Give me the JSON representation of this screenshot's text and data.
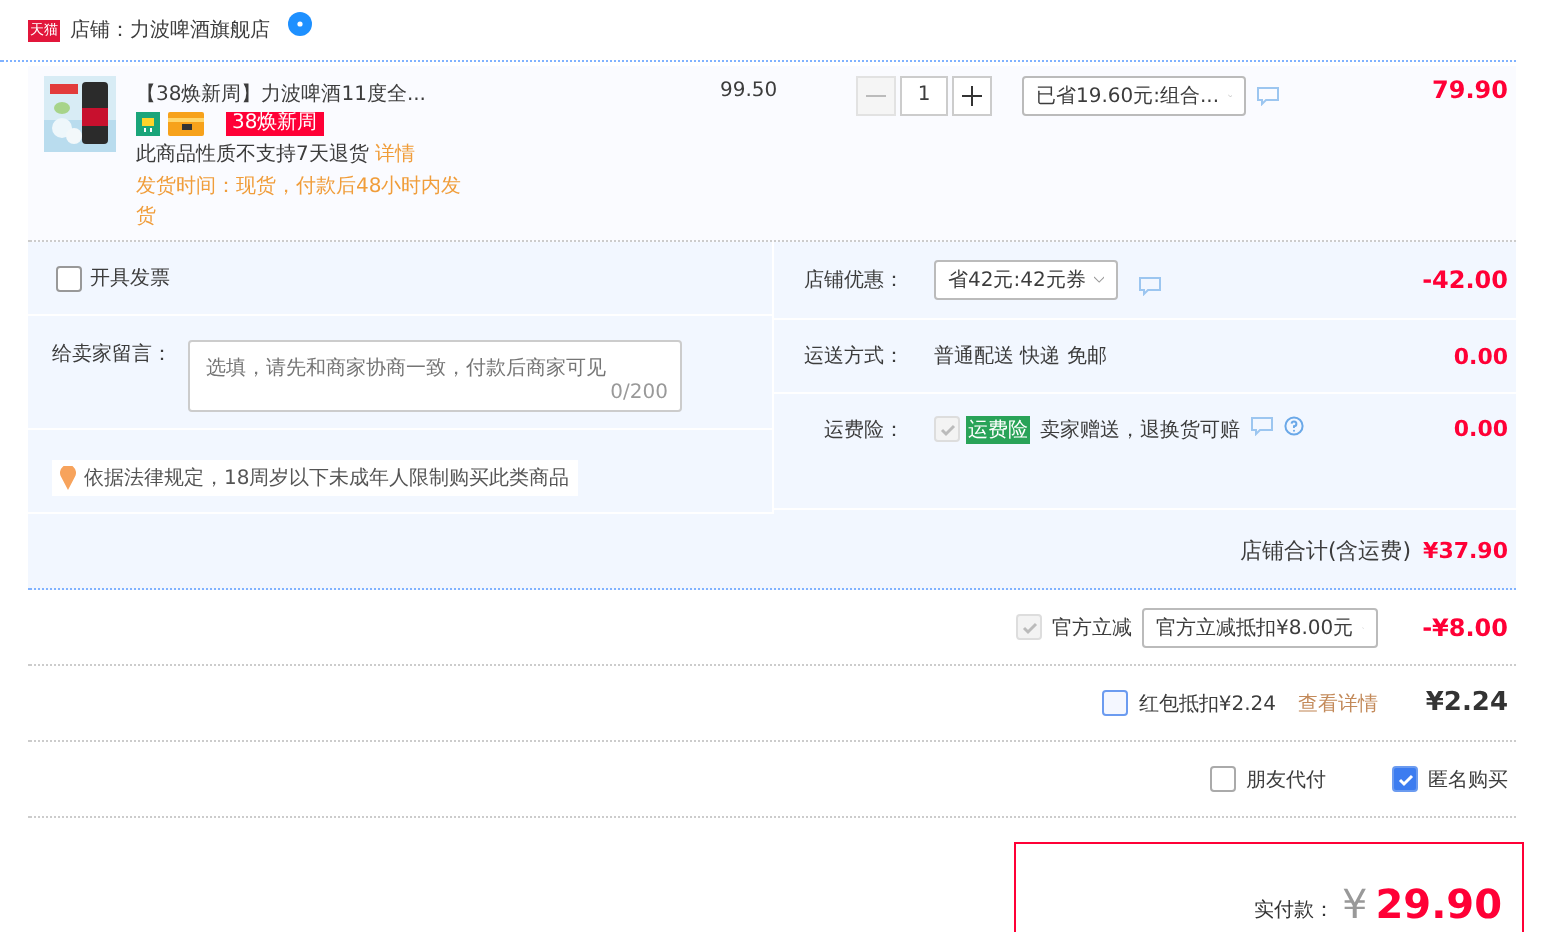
{
  "shop": {
    "badge": "天猫",
    "name": "店铺：力波啤酒旗舰店"
  },
  "item": {
    "title": "【38焕新周】力波啤酒11度全...",
    "promo": "38焕新周",
    "note": "此商品性质不支持7天退货",
    "note_link": "详情",
    "delivery": "发货时间：现货，付款后48小时内发货",
    "unit_price": "99.50",
    "quantity": "1",
    "decrease_disabled": true,
    "discount_option": "已省19.60元:组合...",
    "subtotal": "79.90"
  },
  "invoice": {
    "label": "开具发票",
    "checked": false
  },
  "message": {
    "label": "给卖家留言：",
    "placeholder": "选填，请先和商家协商一致，付款后商家可见",
    "counter": "0/200"
  },
  "notice": "依据法律规定，18周岁以下未成年人限制购买此类商品",
  "shop_discount": {
    "label": "店铺优惠：",
    "option": "省42元:42元券",
    "amount": "-42.00"
  },
  "shipping": {
    "label": "运送方式：",
    "method": "普通配送 快递 免邮",
    "amount": "0.00"
  },
  "insurance": {
    "label": "运费险：",
    "checked": true,
    "disabled": true,
    "tag": "运费险",
    "text": "卖家赠送，退换货可赔",
    "amount": "0.00"
  },
  "shop_total": {
    "label": "店铺合计(含运费)",
    "amount": "¥37.90"
  },
  "official_discount": {
    "label": "官方立减",
    "checked": true,
    "disabled": true,
    "option": "官方立减抵扣¥8.00元",
    "amount": "-¥8.00"
  },
  "cash_coupon": {
    "label": "红包抵扣¥2.24",
    "checked": false,
    "link": "查看详情",
    "amount": "¥2.24"
  },
  "options": [
    {
      "label": "朋友代付",
      "checked": false
    },
    {
      "label": "匿名购买",
      "checked": true
    }
  ],
  "pay": {
    "label": "实付款：",
    "currency": "¥",
    "amount": "29.90"
  }
}
